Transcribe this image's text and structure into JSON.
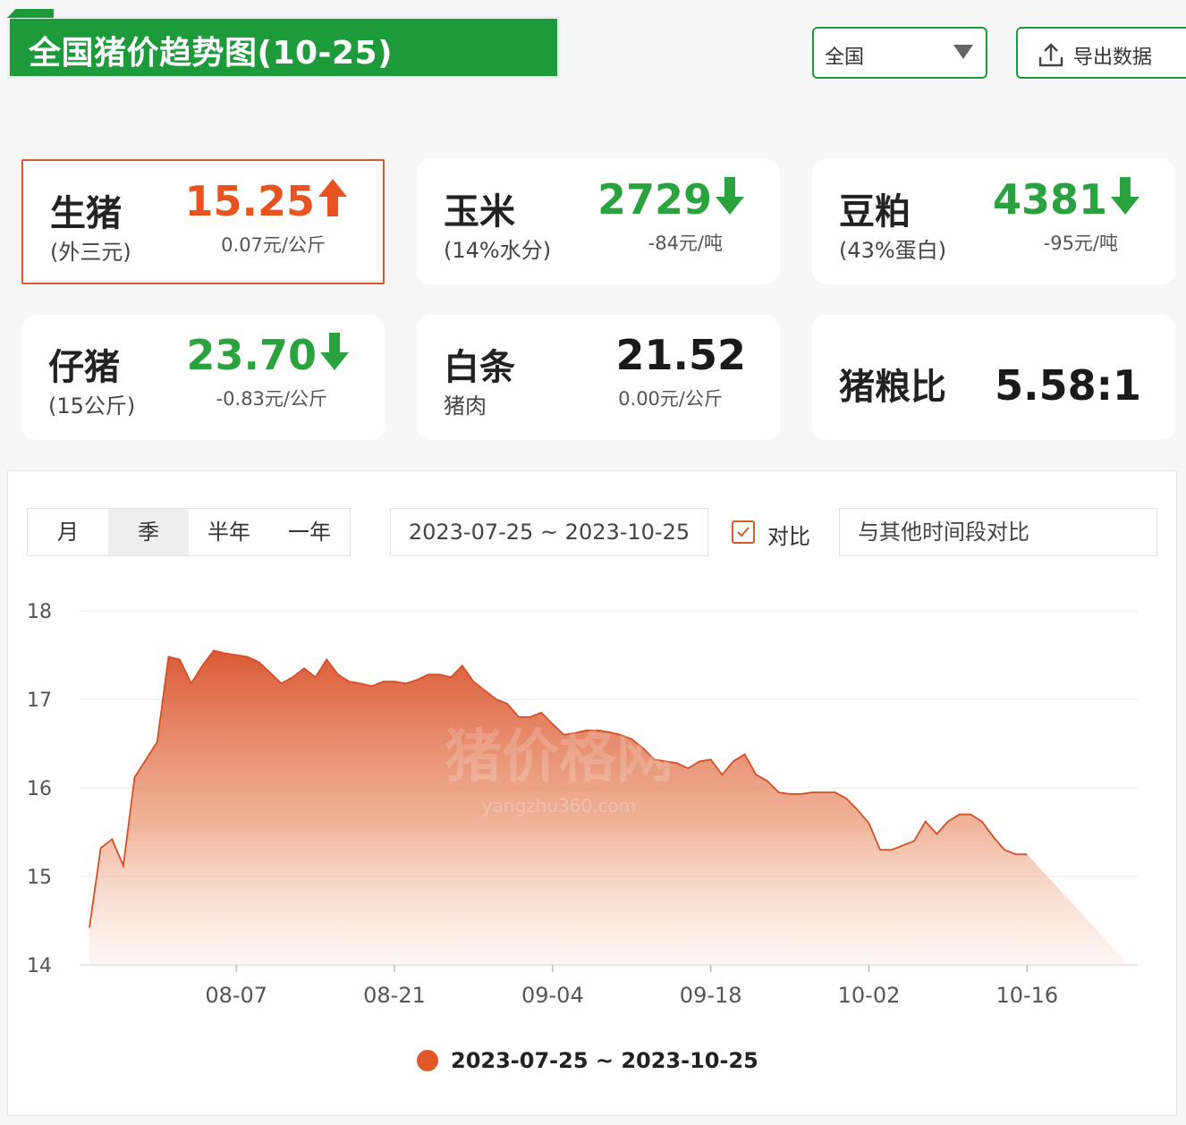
{
  "header": {
    "title": "全国猪价趋势图(10-25)",
    "region": "全国",
    "export_label": "导出数据"
  },
  "cards": [
    {
      "name": "生猪",
      "sub": "(外三元)",
      "price": "15.25",
      "trend": "up",
      "change": "0.07元/公斤",
      "active": true
    },
    {
      "name": "玉米",
      "sub": "(14%水分)",
      "price": "2729",
      "trend": "down",
      "change": "-84元/吨",
      "active": false
    },
    {
      "name": "豆粕",
      "sub": "(43%蛋白)",
      "price": "4381",
      "trend": "down",
      "change": "-95元/吨",
      "active": false
    },
    {
      "name": "仔猪",
      "sub": "(15公斤)",
      "price": "23.70",
      "trend": "down",
      "change": "-0.83元/公斤",
      "active": false
    },
    {
      "name": "白条",
      "sub": "猪肉",
      "price": "21.52",
      "trend": "flat",
      "change": "0.00元/公斤",
      "active": false
    },
    {
      "name": "猪粮比",
      "sub": "",
      "price": "5.58:1",
      "trend": "ratio",
      "change": "",
      "active": false
    }
  ],
  "controls": {
    "range_tabs": [
      "月",
      "季",
      "半年",
      "一年"
    ],
    "selected_tab": "季",
    "date_range": "2023-07-25 ~ 2023-10-25",
    "compare_label": "对比",
    "compare_checked": true,
    "compare_placeholder": "与其他时间段对比"
  },
  "colors": {
    "brand_green": "#1d9a3a",
    "up": "#e8531f",
    "down": "#2aa33f",
    "series": "#e0572a"
  },
  "chart_data": {
    "type": "area",
    "title": "",
    "xlabel": "",
    "ylabel": "",
    "ylim": [
      14,
      18
    ],
    "yticks": [
      14,
      15,
      16,
      17,
      18
    ],
    "grid": true,
    "xticks": [
      "08-07",
      "08-21",
      "09-04",
      "09-18",
      "10-02",
      "10-16"
    ],
    "x": [
      "07-25",
      "07-26",
      "07-27",
      "07-28",
      "07-29",
      "07-30",
      "07-31",
      "08-01",
      "08-02",
      "08-03",
      "08-04",
      "08-05",
      "08-06",
      "08-07",
      "08-08",
      "08-09",
      "08-10",
      "08-11",
      "08-12",
      "08-13",
      "08-14",
      "08-15",
      "08-16",
      "08-17",
      "08-18",
      "08-19",
      "08-20",
      "08-21",
      "08-22",
      "08-23",
      "08-24",
      "08-25",
      "08-26",
      "08-27",
      "08-28",
      "08-29",
      "08-30",
      "08-31",
      "09-01",
      "09-02",
      "09-03",
      "09-04",
      "09-05",
      "09-06",
      "09-07",
      "09-08",
      "09-09",
      "09-10",
      "09-11",
      "09-12",
      "09-13",
      "09-14",
      "09-15",
      "09-16",
      "09-17",
      "09-18",
      "09-19",
      "09-20",
      "09-21",
      "09-22",
      "09-23",
      "09-24",
      "09-25",
      "09-26",
      "09-27",
      "09-28",
      "09-29",
      "09-30",
      "10-01",
      "10-02",
      "10-03",
      "10-04",
      "10-05",
      "10-06",
      "10-07",
      "10-08",
      "10-09",
      "10-10",
      "10-11",
      "10-12",
      "10-13",
      "10-14",
      "10-15",
      "10-16",
      "10-17",
      "10-18",
      "10-19",
      "10-20",
      "10-21",
      "10-22",
      "10-23",
      "10-24",
      "10-25"
    ],
    "series": [
      {
        "name": "2023-07-25 ~ 2023-10-25",
        "values": [
          14.42,
          15.32,
          15.42,
          15.12,
          16.12,
          16.32,
          16.52,
          17.48,
          17.45,
          17.18,
          17.38,
          17.55,
          17.52,
          17.5,
          17.48,
          17.42,
          17.3,
          17.18,
          17.25,
          17.35,
          17.25,
          17.45,
          17.28,
          17.2,
          17.18,
          17.15,
          17.2,
          17.2,
          17.18,
          17.22,
          17.28,
          17.28,
          17.25,
          17.38,
          17.2,
          17.1,
          17.0,
          16.95,
          16.8,
          16.8,
          16.85,
          16.72,
          16.6,
          16.62,
          16.65,
          16.65,
          16.63,
          16.6,
          16.55,
          16.45,
          16.32,
          16.3,
          16.28,
          16.22,
          16.3,
          16.32,
          16.15,
          16.3,
          16.38,
          16.15,
          16.08,
          15.95,
          15.93,
          15.93,
          15.95,
          15.95,
          15.95,
          15.88,
          15.75,
          15.6,
          15.3,
          15.3,
          15.35,
          15.4,
          15.62,
          15.48,
          15.62,
          15.7,
          15.7,
          15.62,
          15.45,
          15.3,
          15.25,
          15.25
        ]
      }
    ],
    "watermark": "猪价格网 yangzhu360.com"
  }
}
